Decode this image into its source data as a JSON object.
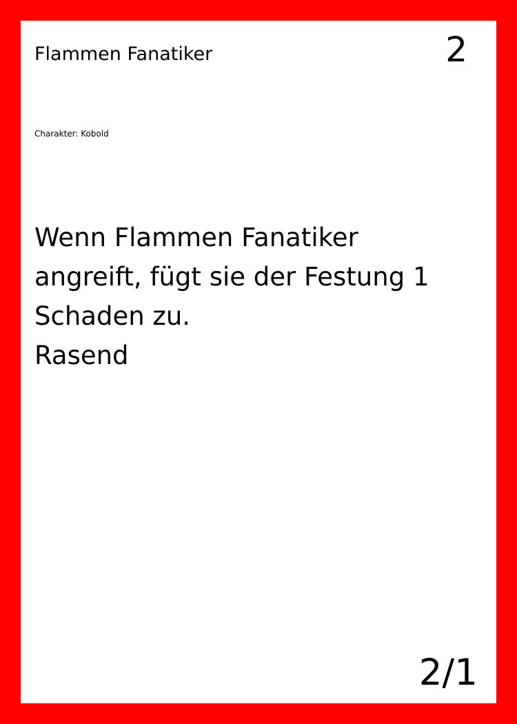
{
  "colors": {
    "frame": "#ff0000",
    "card_background": "#ffffff",
    "text": "#000000"
  },
  "card": {
    "name": "Flammen Fanatiker",
    "cost": "2",
    "type_line": "Charakter: Kobold",
    "rules_text": [
      "Wenn Flammen Fanatiker",
      "angreift, fügt sie der Festung 1",
      "Schaden zu.",
      "Rasend"
    ],
    "stats": "2/1"
  }
}
